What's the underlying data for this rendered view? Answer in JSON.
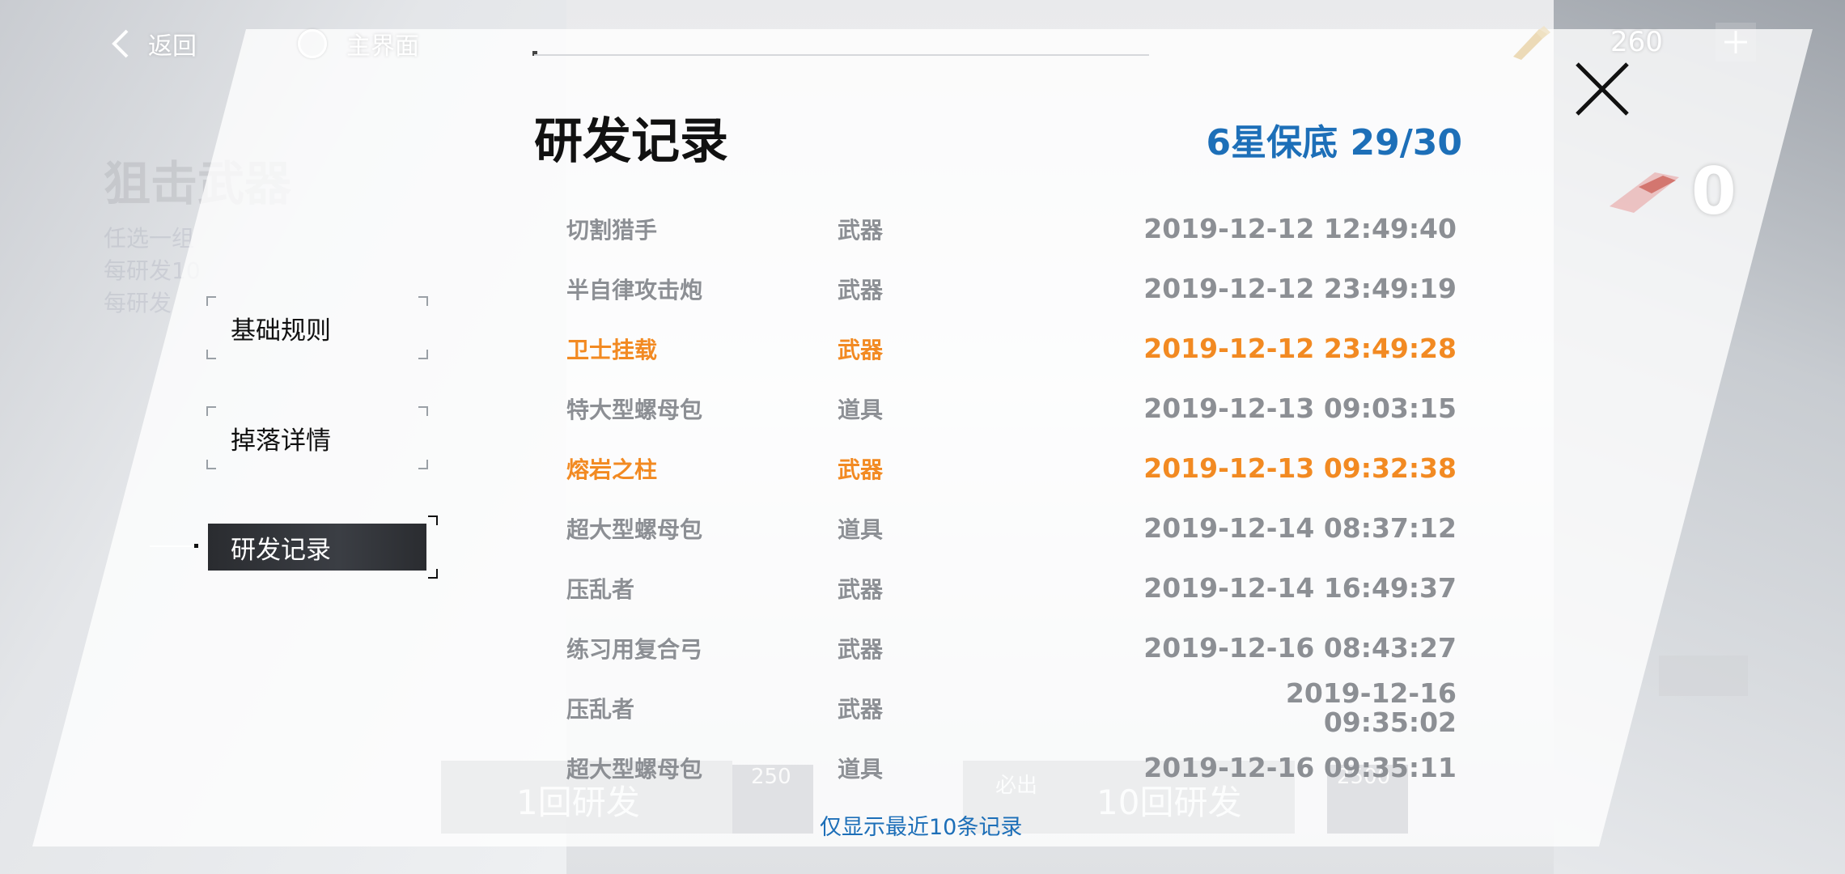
{
  "topbar": {
    "back_label": "返回",
    "home_label": "主界面",
    "currency_value": "260",
    "plus_label": "+"
  },
  "background": {
    "ghost_title": "狙击武器",
    "ghost_lines": [
      "任选一组",
      "每研发10",
      "每研发"
    ],
    "ghost_btn1": "1回研发",
    "ghost_btn1_cost": "250",
    "ghost_btn2": "10回研发",
    "ghost_btn2_tag": "必出",
    "ghost_btn2_cost": "2500"
  },
  "sidebar": {
    "items": [
      {
        "label": "基础规则"
      },
      {
        "label": "掉落详情"
      },
      {
        "label": "研发记录"
      }
    ],
    "active_index": 2
  },
  "panel": {
    "title": "研发记录",
    "pity": "6星保底 29/30",
    "note": "仅显示最近10条记录",
    "right_count": "0",
    "highlight_color": "#f28a22",
    "accent_color": "#1d6fb8",
    "records": [
      {
        "name": "切割猎手",
        "type": "武器",
        "time": "2019-12-12 12:49:40",
        "highlight": false
      },
      {
        "name": "半自律攻击炮",
        "type": "武器",
        "time": "2019-12-12 23:49:19",
        "highlight": false
      },
      {
        "name": "卫士挂载",
        "type": "武器",
        "time": "2019-12-12 23:49:28",
        "highlight": true
      },
      {
        "name": "特大型螺母包",
        "type": "道具",
        "time": "2019-12-13 09:03:15",
        "highlight": false
      },
      {
        "name": "熔岩之柱",
        "type": "武器",
        "time": "2019-12-13 09:32:38",
        "highlight": true
      },
      {
        "name": "超大型螺母包",
        "type": "道具",
        "time": "2019-12-14 08:37:12",
        "highlight": false
      },
      {
        "name": "压乱者",
        "type": "武器",
        "time": "2019-12-14 16:49:37",
        "highlight": false
      },
      {
        "name": "练习用复合弓",
        "type": "武器",
        "time": "2019-12-16 08:43:27",
        "highlight": false
      },
      {
        "name": "压乱者",
        "type": "武器",
        "time": "2019-12-16\n09:35:02",
        "highlight": false
      },
      {
        "name": "超大型螺母包",
        "type": "道具",
        "time": "2019-12-16 09:35:11",
        "highlight": false
      }
    ]
  }
}
